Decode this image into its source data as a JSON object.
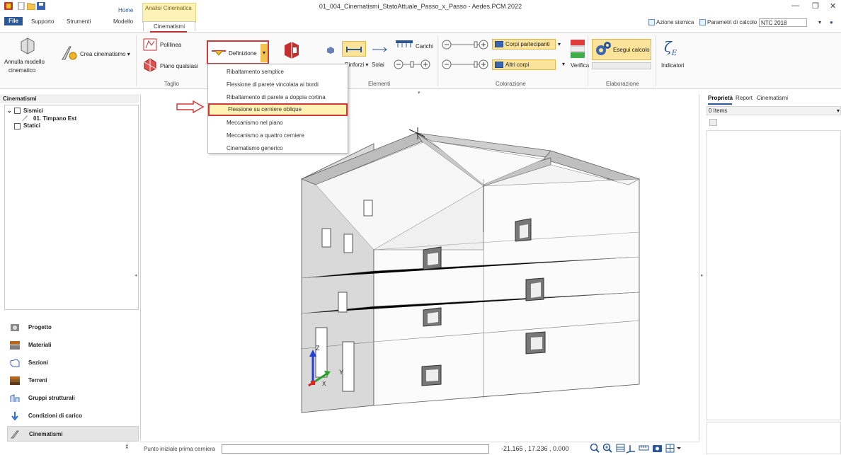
{
  "window": {
    "title": "01_004_Cinematismi_StatoAttuale_Passo_x_Passo - Aedes.PCM 2022",
    "min": "—",
    "restore": "❐",
    "close": "✕"
  },
  "tabs": {
    "file": "File",
    "supporto": "Supporto",
    "strumenti": "Strumenti",
    "modello": "Modello",
    "home": "Home",
    "context_header": "Analisi Cinematica",
    "cinematismi": "Cinematismi"
  },
  "options": {
    "azione_sismica": "Azione sismica",
    "parametri": "Parametri di calcolo",
    "ntc": "NTC 2018"
  },
  "ribbon": {
    "annulla": "Annulla modello cinematico",
    "annulla_l1": "Annulla modello",
    "annulla_l2": "cinematico",
    "crea": "Crea cinematismo",
    "polilinea": "Polilinea",
    "piano": "Piano qualsiasi",
    "taglio": "Taglio",
    "definizione": "Definizione",
    "rinforzi": "Rinforzi",
    "solai": "Solai",
    "carichi": "Carichi",
    "elementi": "Elementi",
    "corpi_partecipanti": "Corpi partecipanti",
    "altri_corpi": "Altri corpi",
    "verifica": "Verifica",
    "colorazione": "Colorazione",
    "esegui": "Esegui calcolo",
    "elaborazione": "Elaborazione",
    "indicatori": "Indicatori",
    "zeta_symbol": "ζ",
    "zeta_sub": "E"
  },
  "menu": {
    "items": [
      "Ribaltamento semplice",
      "Flessione di parete vincolata ai bordi",
      "Ribaltamento di parete a doppia cortina",
      "Flessione su cerniere oblique",
      "Meccanismo nel piano",
      "Meccanismo a quattro cerniere",
      "Cinematismo generico"
    ],
    "selected_index": 3
  },
  "left_panel": {
    "header": "Cinematismi",
    "tree": {
      "sismici": "Sismici",
      "timpano": "01. Timpano Est",
      "statici": "Statici"
    },
    "nav": [
      "Progetto",
      "Materiali",
      "Sezioni",
      "Terreni",
      "Gruppi strutturali",
      "Condizioni di carico",
      "Cinematismi"
    ]
  },
  "right_panel": {
    "tabs": [
      "Proprietà",
      "Report",
      "Cinematismi"
    ],
    "items_count": "0 Items"
  },
  "axes": {
    "x": "X",
    "y": "Y",
    "z": "Z"
  },
  "status": {
    "label": "Punto iniziale prima cerniera",
    "coords": "-21.165 , 17.236 , 0.000"
  },
  "colors": {
    "accent_red": "#d23a3a",
    "file_blue": "#2b5797",
    "context_yellow": "#fff3b8"
  }
}
